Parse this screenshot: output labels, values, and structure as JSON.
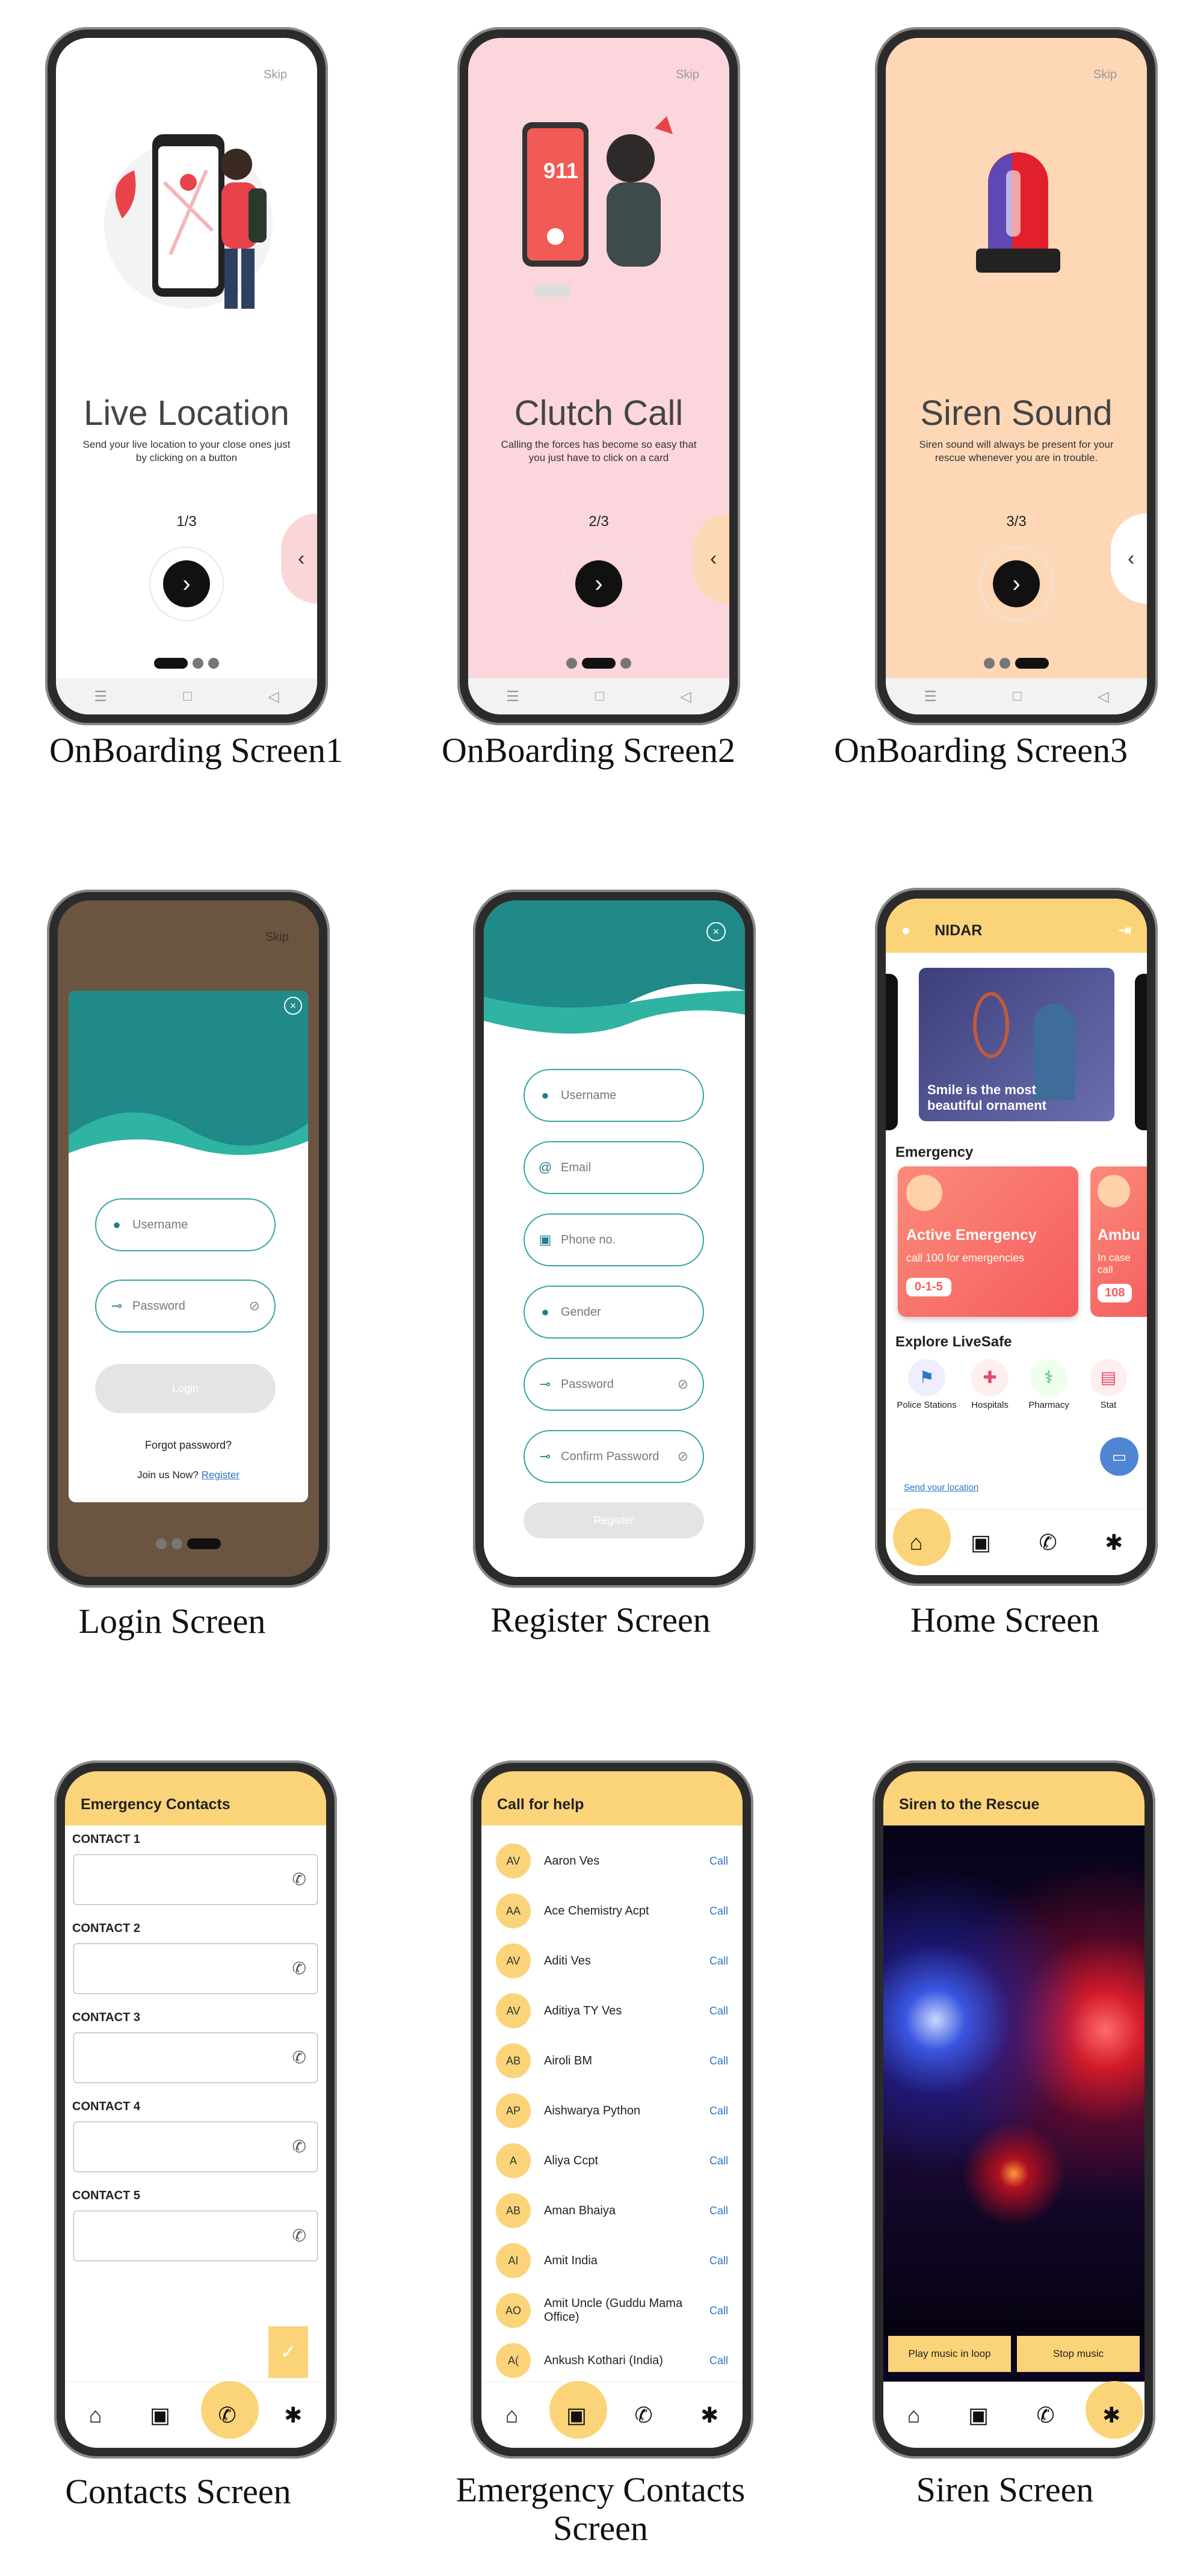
{
  "onboarding": [
    {
      "caption": "OnBoarding Screen1",
      "skip": "Skip",
      "title": "Live Location",
      "desc": "Send your live location to your close ones just by clicking on a button",
      "page": "1/3",
      "bg": "#ffffff",
      "tab_color": "#fbd6d9"
    },
    {
      "caption": "OnBoarding Screen2",
      "skip": "Skip",
      "title": "Clutch Call",
      "desc": "Calling the forces has become so easy that you just have to click on a card",
      "page": "2/3",
      "bg": "#fbd6dc",
      "tab_color": "#fcd9b4",
      "badge": "911"
    },
    {
      "caption": "OnBoarding Screen3",
      "skip": "Skip",
      "title": "Siren Sound",
      "desc": "Siren sound will always be present for your rescue whenever you are in trouble.",
      "page": "3/3",
      "bg": "#fdd7b6",
      "tab_color": "#ffffff"
    }
  ],
  "login": {
    "caption": "Login Screen",
    "skip": "Skip",
    "username": "Username",
    "password": "Password",
    "login_button": "Login",
    "forgot": "Forgot password?",
    "join": "Join us Now?",
    "register_link": "Register"
  },
  "register": {
    "caption": "Register Screen",
    "fields": [
      "Username",
      "Email",
      "Phone no.",
      "Gender",
      "Password",
      "Confirm Password"
    ],
    "register_button": "Register"
  },
  "home": {
    "caption": "Home Screen",
    "app_name": "NIDAR",
    "banner": "Smile is the most beautiful ornament",
    "emergency_heading": "Emergency",
    "card_title": "Active Emergency",
    "card_sub": "call 100 for emergencies",
    "card_number": "0-1-5",
    "card2_title": "Ambu",
    "card2_sub": "In case call",
    "card2_number": "108",
    "explore_heading": "Explore LiveSafe",
    "explore": [
      "Police Stations",
      "Hospitals",
      "Pharmacy",
      "Stat"
    ],
    "send_location": "Send your location"
  },
  "contacts": {
    "caption": "Contacts Screen",
    "title": "Emergency Contacts",
    "labels": [
      "CONTACT 1",
      "CONTACT 2",
      "CONTACT 3",
      "CONTACT 4",
      "CONTACT 5"
    ]
  },
  "callhelp": {
    "caption_line1": "Emergency Contacts",
    "caption_line2": "Screen",
    "title": "Call for help",
    "call_label": "Call",
    "rows": [
      {
        "av": "AV",
        "name": "Aaron Ves"
      },
      {
        "av": "AA",
        "name": "Ace Chemistry Acpt"
      },
      {
        "av": "AV",
        "name": "Aditi Ves"
      },
      {
        "av": "AV",
        "name": "Aditiya TY Ves"
      },
      {
        "av": "AB",
        "name": "Airoli BM"
      },
      {
        "av": "AP",
        "name": "Aishwarya Python"
      },
      {
        "av": "A",
        "name": "Aliya Ccpt"
      },
      {
        "av": "AB",
        "name": "Aman Bhaiya"
      },
      {
        "av": "AI",
        "name": "Amit India"
      },
      {
        "av": "AO",
        "name": "Amit Uncle (Guddu Mama Office)"
      },
      {
        "av": "A(",
        "name": "Ankush Kothari (India)"
      }
    ]
  },
  "siren": {
    "caption": "Siren Screen",
    "title": "Siren to the Rescue",
    "play": "Play music in loop",
    "stop": "Stop music"
  },
  "colors": {
    "accent": "#fbd47a",
    "teal": "#1f8a87",
    "call_blue": "#2a75c8"
  }
}
